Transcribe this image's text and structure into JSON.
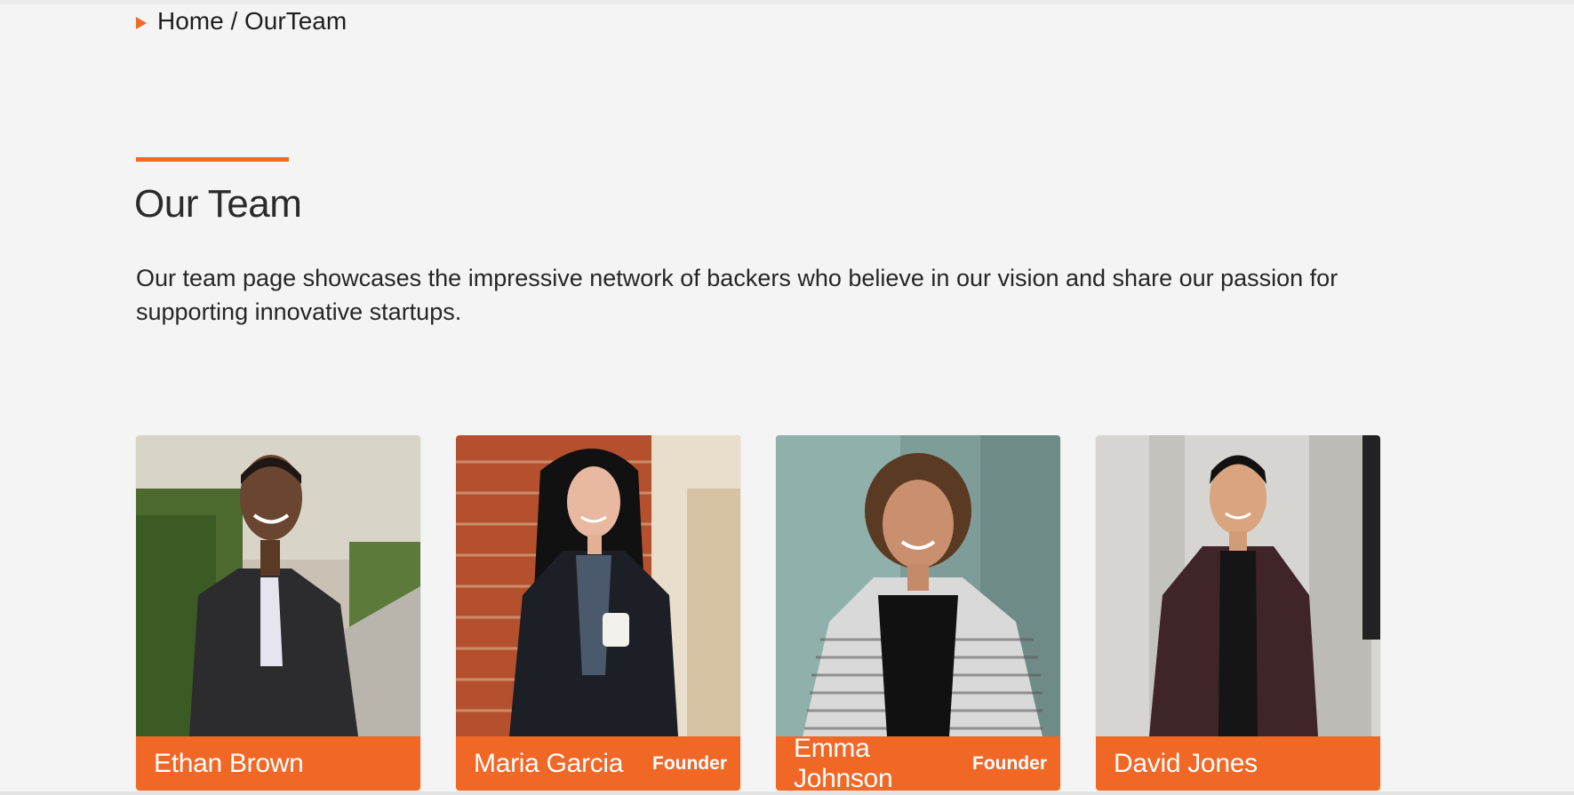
{
  "breadcrumb": {
    "text": "Home / OurTeam"
  },
  "section": {
    "title": "Our Team",
    "intro": "Our team page showcases the impressive network of backers who believe in our vision and share our passion for supporting innovative startups."
  },
  "team": [
    {
      "name": "Ethan Brown",
      "role": ""
    },
    {
      "name": "Maria Garcia",
      "role": "Founder"
    },
    {
      "name": "Emma Johnson",
      "role": "Founder"
    },
    {
      "name": "David Jones",
      "role": ""
    }
  ],
  "colors": {
    "accent": "#f06726",
    "background": "#f4f4f4",
    "text": "#222222"
  }
}
